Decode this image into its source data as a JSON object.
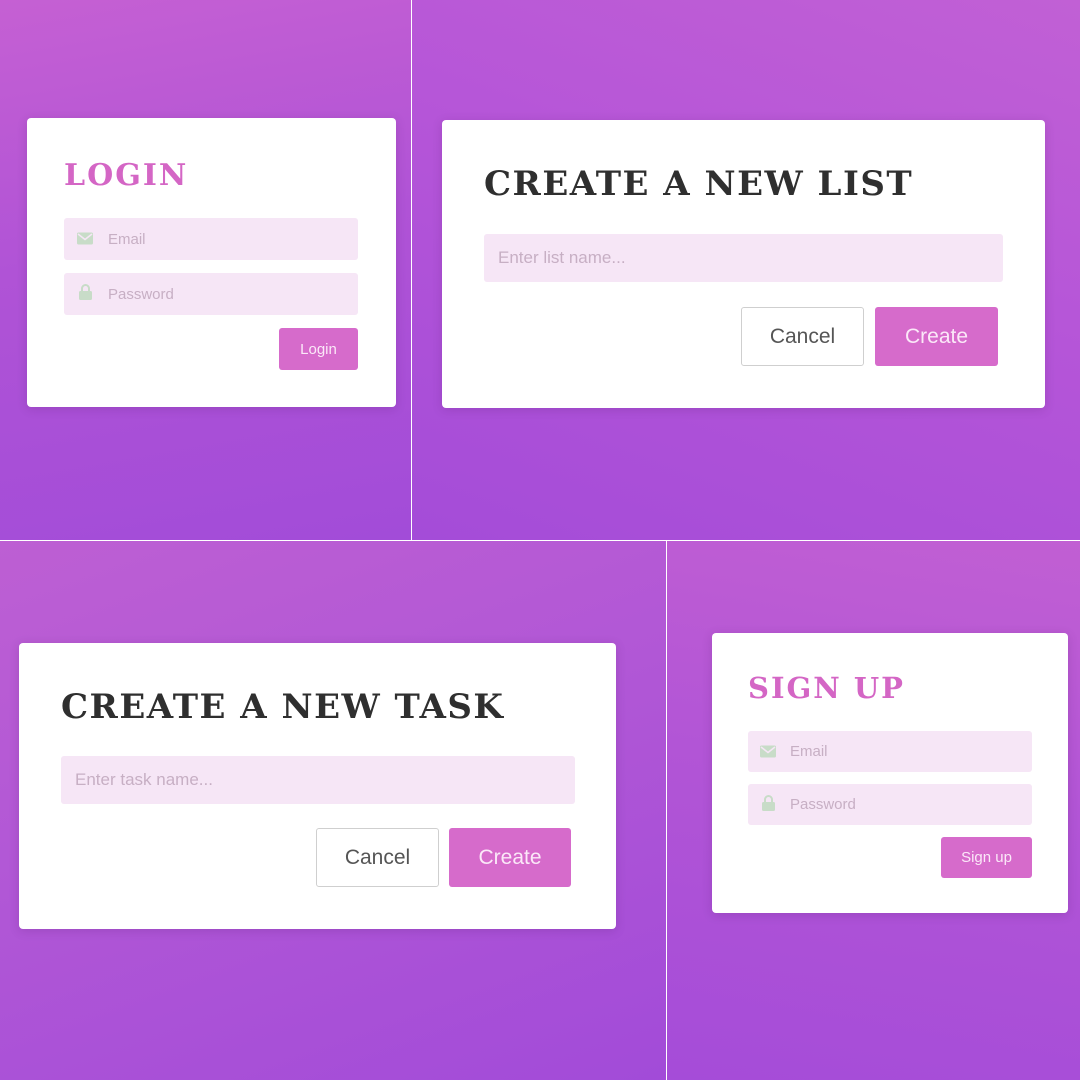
{
  "login": {
    "title": "LOGIN",
    "email": {
      "icon": "envelope-icon",
      "placeholder": "Email",
      "value": ""
    },
    "password": {
      "icon": "lock-icon",
      "placeholder": "Password",
      "value": ""
    },
    "submit_label": "Login"
  },
  "create_list": {
    "title": "CREATE A NEW LIST",
    "name": {
      "placeholder": "Enter list name...",
      "value": ""
    },
    "cancel_label": "Cancel",
    "create_label": "Create"
  },
  "create_task": {
    "title": "CREATE A NEW TASK",
    "name": {
      "placeholder": "Enter task name...",
      "value": ""
    },
    "cancel_label": "Cancel",
    "create_label": "Create"
  },
  "signup": {
    "title": "SIGN UP",
    "email": {
      "icon": "envelope-icon",
      "placeholder": "Email",
      "value": ""
    },
    "password": {
      "icon": "lock-icon",
      "placeholder": "Password",
      "value": ""
    },
    "submit_label": "Sign up"
  },
  "colors": {
    "background_start": "#c560d3",
    "background_end": "#a24cd8",
    "accent": "#d66bcb",
    "input_bg": "#f6e6f6",
    "title_dark": "#2f2f2f",
    "icon": "#c8dcc8"
  }
}
